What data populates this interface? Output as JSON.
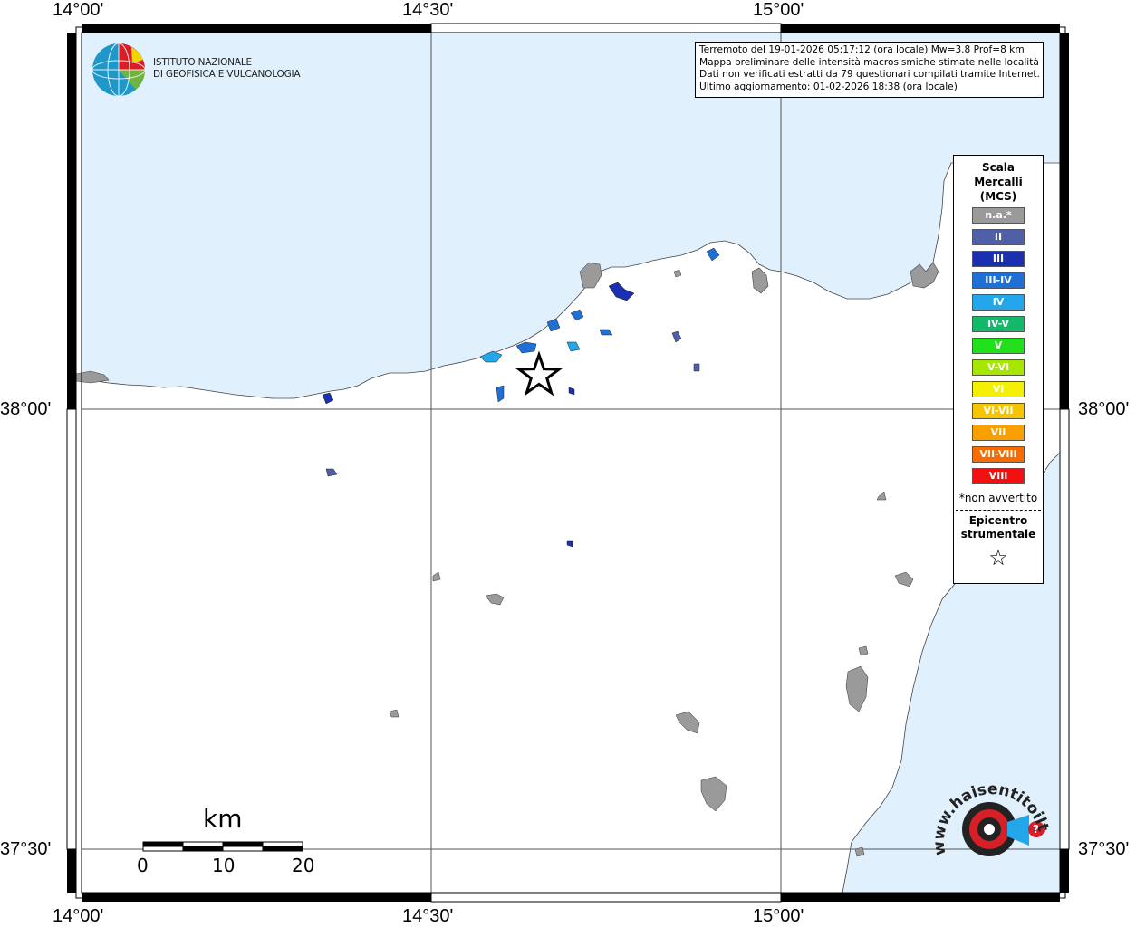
{
  "coordinates": {
    "lon_top": [
      "14°00'",
      "14°30'",
      "15°00'"
    ],
    "lon_bottom": [
      "14°00'",
      "14°30'",
      "15°00'"
    ],
    "lat_left": [
      "38°00'",
      "37°30'"
    ],
    "lat_right": [
      "38°00'",
      "37°30'"
    ]
  },
  "institute": {
    "name_line1": "ISTITUTO NAZIONALE",
    "name_line2": "DI GEOFISICA E VULCANOLOGIA"
  },
  "info": {
    "line1": "Terremoto del 19-01-2026 05:17:12 (ora locale) Mw=3.8 Prof=8 km",
    "line2": "Mappa preliminare delle intensità macrosismiche stimate nelle località",
    "line3": "Dati non verificati estratti da 79 questionari compilati tramite Internet.",
    "line4": "Ultimo aggiornamento: 01-02-2026 18:38 (ora locale)"
  },
  "legend": {
    "title1": "Scala",
    "title2": "Mercalli",
    "title3": "(MCS)",
    "items": [
      {
        "label": "n.a.*",
        "color": "#9a9a9a"
      },
      {
        "label": "II",
        "color": "#4f5fa8"
      },
      {
        "label": "III",
        "color": "#1a30b0"
      },
      {
        "label": "III-IV",
        "color": "#1e6fd6"
      },
      {
        "label": "IV",
        "color": "#23a6ea"
      },
      {
        "label": "IV-V",
        "color": "#13b86a"
      },
      {
        "label": "V",
        "color": "#22e01c"
      },
      {
        "label": "V-VI",
        "color": "#a6e600"
      },
      {
        "label": "VI",
        "color": "#f4f000"
      },
      {
        "label": "VI-VII",
        "color": "#f7c400"
      },
      {
        "label": "VII",
        "color": "#f9a000"
      },
      {
        "label": "VII-VIII",
        "color": "#f76c00"
      },
      {
        "label": "VIII",
        "color": "#f31010"
      }
    ],
    "note": "*non avvertito",
    "epicenter1": "Epicentro",
    "epicenter2": "strumentale",
    "epicenter_icon": "star-outline-icon"
  },
  "scale": {
    "unit": "km",
    "ticks": [
      "0",
      "10",
      "20"
    ]
  },
  "colors": {
    "sea": "#e0f0fc",
    "land": "#ffffff"
  },
  "brand_text": "www.haisentitoilterremoto.it"
}
